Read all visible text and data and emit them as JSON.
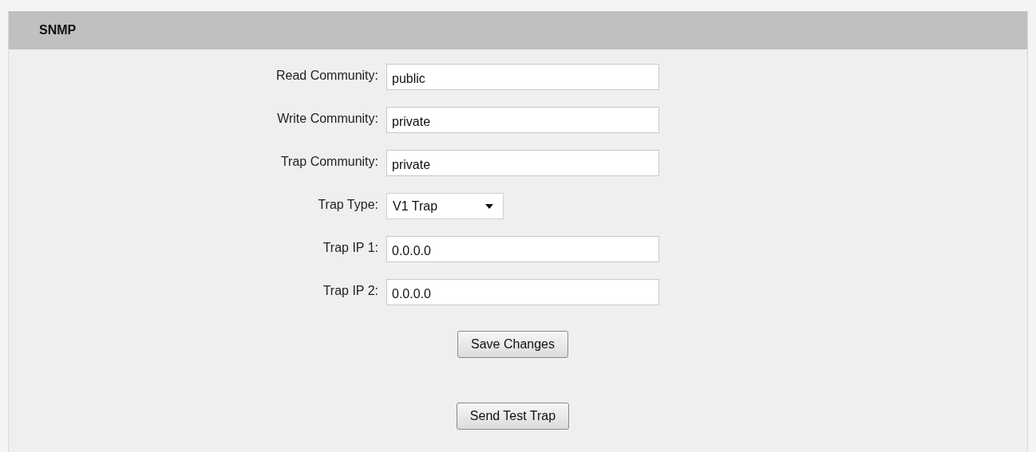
{
  "panel": {
    "title": "SNMP"
  },
  "fields": [
    {
      "kind": "text",
      "label": "Read Community:",
      "value": "public"
    },
    {
      "kind": "text",
      "label": "Write Community:",
      "value": "private"
    },
    {
      "kind": "text",
      "label": "Trap Community:",
      "value": "private"
    },
    {
      "kind": "select",
      "label": "Trap Type:",
      "value": "V1 Trap"
    },
    {
      "kind": "text",
      "label": "Trap IP 1:",
      "value": "0.0.0.0"
    },
    {
      "kind": "text",
      "label": "Trap IP 2:",
      "value": "0.0.0.0"
    }
  ],
  "buttons": [
    "Save Changes",
    "Send Test Trap"
  ]
}
